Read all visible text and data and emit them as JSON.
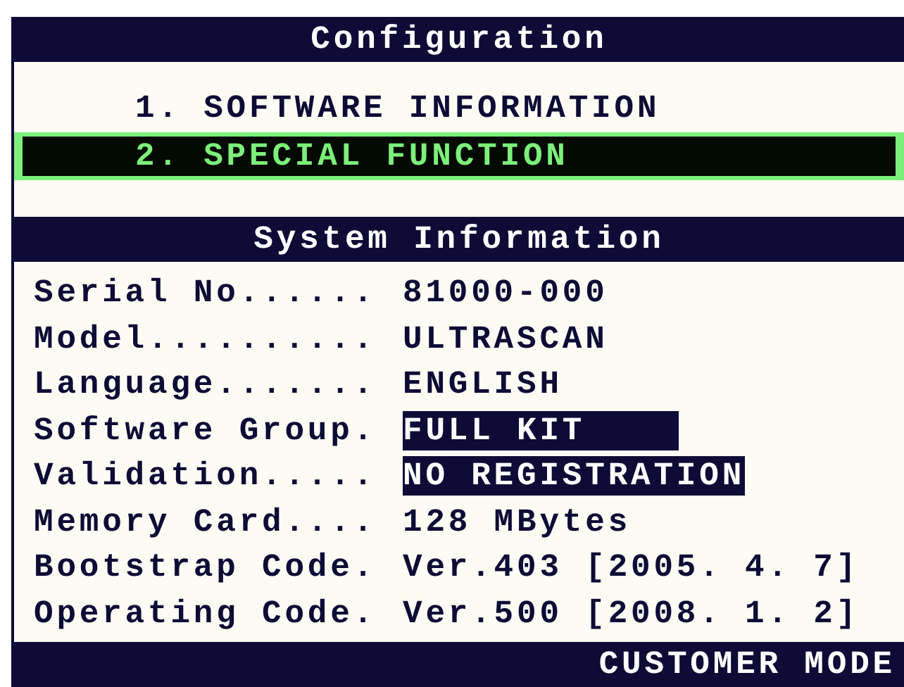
{
  "title": "Configuration",
  "menu": [
    {
      "label": "1. SOFTWARE INFORMATION",
      "selected": false
    },
    {
      "label": "2. SPECIAL FUNCTION",
      "selected": true
    }
  ],
  "section_title": "System Information",
  "info_rows": [
    {
      "label": "Serial No......",
      "value": "81000-000",
      "highlighted": false
    },
    {
      "label": "Model..........",
      "value": "ULTRASCAN",
      "highlighted": false
    },
    {
      "label": "Language.......",
      "value": "ENGLISH",
      "highlighted": false
    },
    {
      "label": "Software Group.",
      "value": "FULL KIT",
      "highlighted": true
    },
    {
      "label": "Validation.....",
      "value": "NO REGISTRATION",
      "highlighted": true
    },
    {
      "label": "Memory Card....",
      "value": "128 MBytes",
      "highlighted": false
    },
    {
      "label": "Bootstrap Code.",
      "value": "Ver.403 [2005. 4. 7]",
      "highlighted": false
    },
    {
      "label": "Operating Code.",
      "value": "Ver.500 [2008. 1. 2]",
      "highlighted": false
    }
  ],
  "status": "CUSTOMER MODE"
}
